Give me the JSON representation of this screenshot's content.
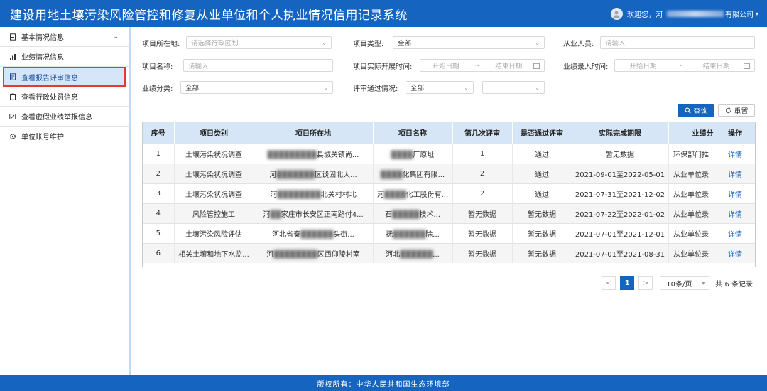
{
  "header": {
    "title": "建设用地土壤污染风险管控和修复从业单位和个人执业情况信用记录系统",
    "welcome": "欢迎您，河",
    "company_suffix": "有限公司"
  },
  "sidebar": {
    "items": [
      {
        "label": "基本情况信息"
      },
      {
        "label": "业绩情况信息"
      },
      {
        "label": "查看报告评审信息"
      },
      {
        "label": "查看行政处罚信息"
      },
      {
        "label": "查看虚假业绩举报信息"
      },
      {
        "label": "单位账号维护"
      }
    ]
  },
  "filters": {
    "location_label": "项目所在地:",
    "location_placeholder": "请选择行政区划",
    "type_label": "项目类型:",
    "type_value": "全部",
    "person_label": "从业人员:",
    "person_placeholder": "请输入",
    "name_label": "项目名称:",
    "name_placeholder": "请输入",
    "actual_time_label": "项目实际开展时间:",
    "entry_time_label": "业绩录入时间:",
    "start_placeholder": "开始日期",
    "end_placeholder": "结束日期",
    "tilde": "~",
    "category_label": "业绩分类:",
    "category_value": "全部",
    "review_label": "评审通过情况:",
    "review_value": "全部",
    "query_label": "查询",
    "reset_label": "重置"
  },
  "table": {
    "headers": [
      "序号",
      "项目类别",
      "项目所在地",
      "项目名称",
      "第几次评审",
      "是否通过评审",
      "实际完成期限",
      "业绩分",
      "操作"
    ],
    "rows": [
      {
        "no": "1",
        "category": "土壤污染状况调查",
        "loc_a": "",
        "loc_b": "县城关镇尚...",
        "name_a": "",
        "name_b": "厂原址",
        "times": "1",
        "passed": "通过",
        "period": "暂无数据",
        "perf": "环保部门推",
        "op": "详情"
      },
      {
        "no": "2",
        "category": "土壤污染状况调查",
        "loc_a": "河",
        "loc_b": "区谈固北大...",
        "name_a": "",
        "name_b": "化集团有限...",
        "times": "2",
        "passed": "通过",
        "period": "2021-09-01至2022-05-01",
        "perf": "从业单位录",
        "op": "详情"
      },
      {
        "no": "3",
        "category": "土壤污染状况调查",
        "loc_a": "河",
        "loc_b": "北关村村北",
        "name_a": "河",
        "name_b": "化工股份有...",
        "times": "2",
        "passed": "通过",
        "period": "2021-07-31至2021-12-02",
        "perf": "从业单位录",
        "op": "详情"
      },
      {
        "no": "4",
        "category": "风险管控施工",
        "loc_a": "河",
        "loc_b": "家庄市长安区正南路付4...",
        "name_a": "石",
        "name_b": "技术...",
        "times": "暂无数据",
        "passed": "暂无数据",
        "period": "2021-07-22至2022-01-02",
        "perf": "从业单位录",
        "op": "详情"
      },
      {
        "no": "5",
        "category": "土壤污染风险评估",
        "loc_a": "河北省秦",
        "loc_b": "头街...",
        "name_a": "抚",
        "name_b": "除...",
        "times": "暂无数据",
        "passed": "暂无数据",
        "period": "2021-07-01至2021-12-01",
        "perf": "从业单位录",
        "op": "详情"
      },
      {
        "no": "6",
        "category": "相关土壤和地下水监...",
        "loc_a": "河",
        "loc_b": "区西仰陵村南",
        "name_a": "河北",
        "name_b": "...",
        "times": "暂无数据",
        "passed": "暂无数据",
        "period": "2021-07-01至2021-08-31",
        "perf": "从业单位录",
        "op": "详情"
      }
    ]
  },
  "pagination": {
    "prev": "<",
    "current": "1",
    "next": ">",
    "page_size": "10条/页",
    "total": "共 6 条记录"
  },
  "footer": {
    "copyright": "版权所有：中华人民共和国生态环境部"
  }
}
